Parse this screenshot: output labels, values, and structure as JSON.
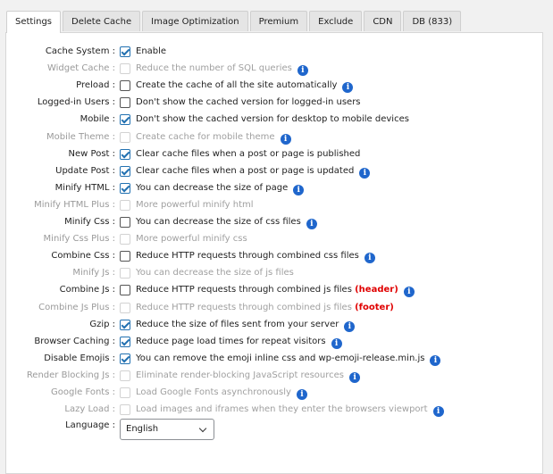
{
  "tabs": [
    {
      "label": "Settings",
      "active": true
    },
    {
      "label": "Delete Cache",
      "active": false
    },
    {
      "label": "Image Optimization",
      "active": false
    },
    {
      "label": "Premium",
      "active": false
    },
    {
      "label": "Exclude",
      "active": false
    },
    {
      "label": "CDN",
      "active": false
    },
    {
      "label": "DB (833)",
      "active": false
    }
  ],
  "settings": [
    {
      "label": "Cache System :",
      "desc": "Enable",
      "checked": true,
      "disabled": false,
      "info": false
    },
    {
      "label": "Widget Cache :",
      "desc": "Reduce the number of SQL queries",
      "checked": false,
      "disabled": true,
      "info": true
    },
    {
      "label": "Preload :",
      "desc": "Create the cache of all the site automatically",
      "checked": false,
      "disabled": false,
      "info": true
    },
    {
      "label": "Logged-in Users :",
      "desc": "Don't show the cached version for logged-in users",
      "checked": false,
      "disabled": false,
      "info": false
    },
    {
      "label": "Mobile :",
      "desc": "Don't show the cached version for desktop to mobile devices",
      "checked": true,
      "disabled": false,
      "info": false
    },
    {
      "label": "Mobile Theme :",
      "desc": "Create cache for mobile theme",
      "checked": false,
      "disabled": true,
      "info": true
    },
    {
      "label": "New Post :",
      "desc": "Clear cache files when a post or page is published",
      "checked": true,
      "disabled": false,
      "info": false
    },
    {
      "label": "Update Post :",
      "desc": "Clear cache files when a post or page is updated",
      "checked": true,
      "disabled": false,
      "info": true
    },
    {
      "label": "Minify HTML :",
      "desc": "You can decrease the size of page",
      "checked": true,
      "disabled": false,
      "info": true
    },
    {
      "label": "Minify HTML Plus :",
      "desc": "More powerful minify html",
      "checked": false,
      "disabled": true,
      "info": false
    },
    {
      "label": "Minify Css :",
      "desc": "You can decrease the size of css files",
      "checked": false,
      "disabled": false,
      "info": true
    },
    {
      "label": "Minify Css Plus :",
      "desc": "More powerful minify css",
      "checked": false,
      "disabled": true,
      "info": false
    },
    {
      "label": "Combine Css :",
      "desc": "Reduce HTTP requests through combined css files",
      "checked": false,
      "disabled": false,
      "info": true
    },
    {
      "label": "Minify Js :",
      "desc": "You can decrease the size of js files",
      "checked": false,
      "disabled": true,
      "info": false
    },
    {
      "label": "Combine Js :",
      "desc": "Reduce HTTP requests through combined js files",
      "highlight": "(header)",
      "checked": false,
      "disabled": false,
      "info": true
    },
    {
      "label": "Combine Js Plus :",
      "desc": "Reduce HTTP requests through combined js files",
      "highlight": "(footer)",
      "checked": false,
      "disabled": true,
      "info": false
    },
    {
      "label": "Gzip :",
      "desc": "Reduce the size of files sent from your server",
      "checked": true,
      "disabled": false,
      "info": true
    },
    {
      "label": "Browser Caching :",
      "desc": "Reduce page load times for repeat visitors",
      "checked": true,
      "disabled": false,
      "info": true
    },
    {
      "label": "Disable Emojis :",
      "desc": "You can remove the emoji inline css and wp-emoji-release.min.js",
      "checked": true,
      "disabled": false,
      "info": true
    },
    {
      "label": "Render Blocking Js :",
      "desc": "Eliminate render-blocking JavaScript resources",
      "checked": false,
      "disabled": true,
      "info": true
    },
    {
      "label": "Google Fonts :",
      "desc": "Load Google Fonts asynchronously",
      "checked": false,
      "disabled": true,
      "info": true
    },
    {
      "label": "Lazy Load :",
      "desc": "Load images and iframes when they enter the browsers viewport",
      "checked": false,
      "disabled": true,
      "info": true
    }
  ],
  "language": {
    "label": "Language :",
    "value": "English"
  },
  "icons": {
    "info": "info-icon",
    "check": "checkmark-icon",
    "dropdown": "chevron-down-icon"
  },
  "colors": {
    "accent": "#2271b1",
    "info": "#1f66cc",
    "highlight": "#e00000"
  }
}
